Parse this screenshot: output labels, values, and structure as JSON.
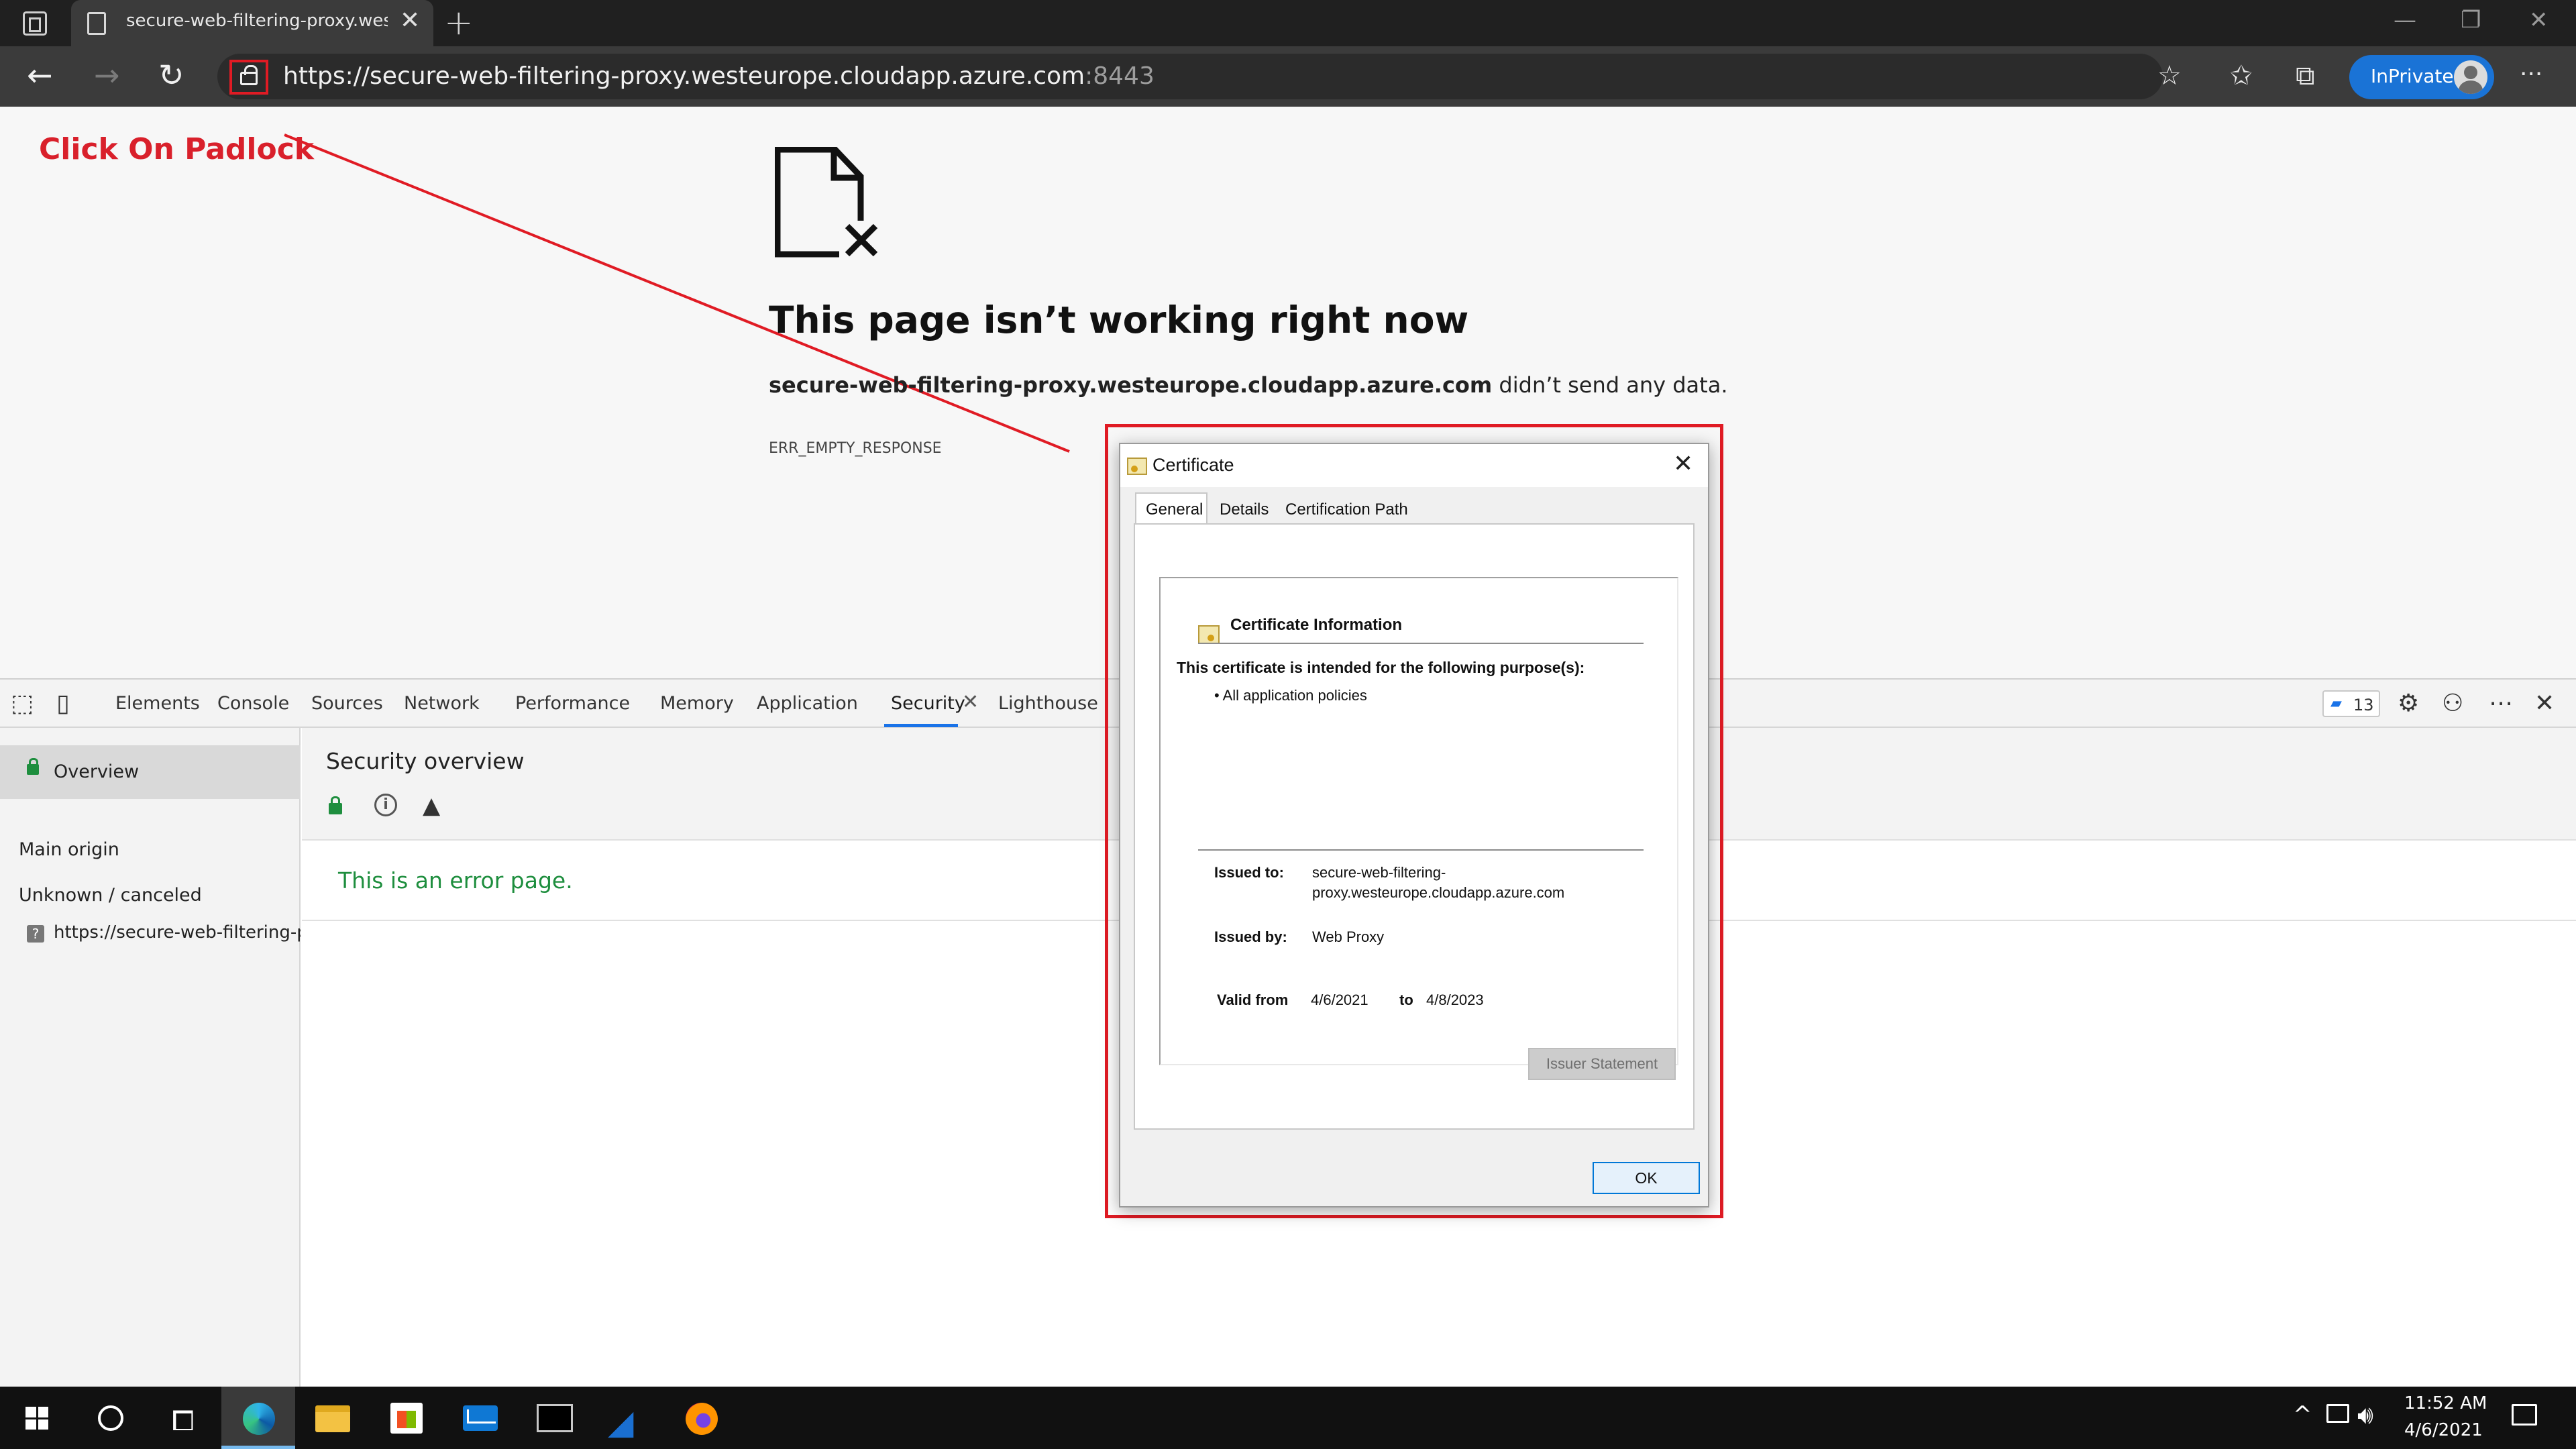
{
  "browser": {
    "tab_title": "secure-web-filtering-proxy.westeurope.cloudapp.azure.com",
    "tab_close": "✕",
    "new_tab": "+",
    "url_main": "https://secure-web-filtering-proxy.westeurope.cloudapp.azure.com",
    "url_port": ":8443",
    "inprivate_label": "InPrivate",
    "more": "···"
  },
  "annotation": {
    "text": "Click On Padlock",
    "color": "#d9202b"
  },
  "error_page": {
    "title": "This page isn’t working right now",
    "host": "secure-web-filtering-proxy.westeurope.cloudapp.azure.com",
    "message_suffix": " didn’t send any data.",
    "code": "ERR_EMPTY_RESPONSE"
  },
  "devtools": {
    "tabs": [
      "Elements",
      "Console",
      "Sources",
      "Network",
      "Performance",
      "Memory",
      "Application",
      "Security",
      "Lighthouse"
    ],
    "active_tab": "Security",
    "issues_count": "13",
    "sidebar": {
      "overview": "Overview",
      "main_origin": "Main origin",
      "unknown": "Unknown / canceled",
      "origin_url": "https://secure-web-filtering-proxy.westeurope.cloudapp.azure.com"
    },
    "security": {
      "title": "Security overview",
      "message": "This is an error page.",
      "accent_color": "#1e8e3e"
    }
  },
  "certificate": {
    "title": "Certificate",
    "tabs": [
      "General",
      "Details",
      "Certification Path"
    ],
    "info_heading": "Certificate Information",
    "purpose_heading": "This certificate is intended for the following purpose(s):",
    "policy": "• All application policies",
    "issued_to_label": "Issued to:",
    "issued_to_line1": "secure-web-filtering-",
    "issued_to_line2": "proxy.westeurope.cloudapp.azure.com",
    "issued_by_label": "Issued by:",
    "issued_by": "Web Proxy",
    "valid_from_label": "Valid from",
    "valid_from": "4/6/2021",
    "to_label": "to",
    "valid_to": "4/8/2023",
    "issuer_statement": "Issuer Statement",
    "ok": "OK"
  },
  "taskbar": {
    "time": "11:52 AM",
    "date": "4/6/2021"
  }
}
